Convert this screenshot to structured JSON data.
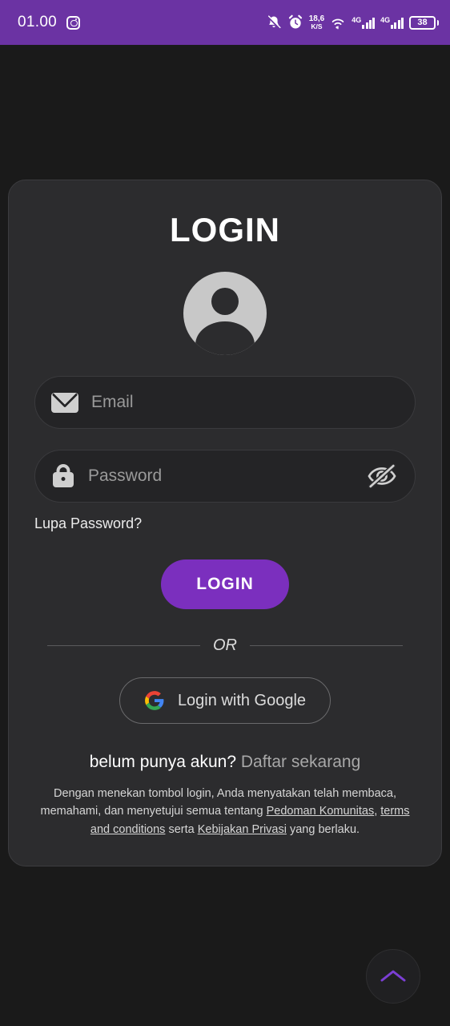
{
  "statusbar": {
    "time": "01.00",
    "instagram_icon": "instagram-icon",
    "notification_muted_icon": "bell-muted-icon",
    "alarm_icon": "alarm-clock-icon",
    "data_speed_value": "18,6",
    "data_speed_unit": "K/S",
    "wifi_icon": "wifi-icon",
    "network_1_label": "4G",
    "network_2_label": "4G",
    "battery_percent": "38",
    "background_color": "#6b33a3"
  },
  "card": {
    "title": "LOGIN",
    "avatar_icon": "user-avatar-icon",
    "email": {
      "icon": "envelope-icon",
      "placeholder": "Email",
      "value": ""
    },
    "password": {
      "icon": "lock-icon",
      "placeholder": "Password",
      "value": "",
      "toggle_icon": "eye-off-icon"
    },
    "forgot_password_label": "Lupa Password?",
    "login_button_label": "LOGIN",
    "divider_label": "OR",
    "google_button_label": "Login with Google",
    "google_icon": "google-g-icon",
    "signup_question": "belum punya akun?",
    "signup_action": "Daftar sekarang",
    "legal": {
      "part1": "Dengan menekan tombol login, Anda menyatakan telah membaca, memahami, dan menyetujui semua tentang ",
      "link1": "Pedoman Komunitas",
      "part2": ", ",
      "link2": "terms and conditions",
      "part3": " serta ",
      "link3": "Kebijakan Privasi",
      "part4": " yang berlaku."
    },
    "accent_color": "#7b2fbe",
    "background_color": "#2c2c2e"
  },
  "fab": {
    "icon": "chevron-up-icon",
    "accent_color": "#7b3fd4"
  }
}
